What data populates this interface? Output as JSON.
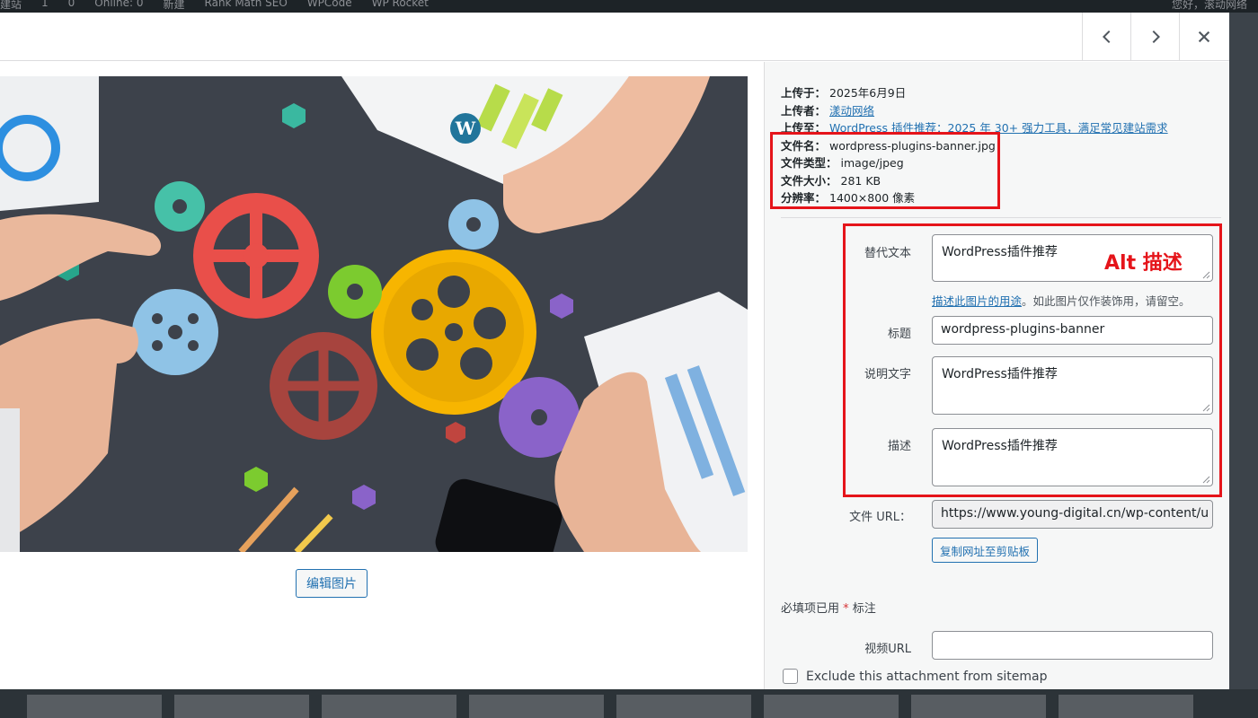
{
  "admin_bar": {
    "items": [
      "建站",
      "1",
      "0",
      "Online: 0",
      "新建",
      "Rank Math SEO",
      "WPCode",
      "WP Rocket"
    ],
    "right_text": "您好，滚动网络"
  },
  "nav": {
    "prev_icon": "chevron-left-icon",
    "next_icon": "chevron-right-icon",
    "close_icon": "close-icon"
  },
  "image": {
    "edit_button": "编辑图片"
  },
  "details": {
    "uploaded_on_label": "上传于：",
    "uploaded_on": "2025年6月9日",
    "uploaded_by_label": "上传者：",
    "uploaded_by": "漾动网络",
    "uploaded_to_label": "上传至：",
    "uploaded_to": "WordPress 插件推荐：2025 年 30+ 强力工具，满足常见建站需求",
    "file_name_label": "文件名：",
    "file_name": "wordpress-plugins-banner.jpg",
    "file_type_label": "文件类型：",
    "file_type": "image/jpeg",
    "file_size_label": "文件大小：",
    "file_size": "281 KB",
    "dimensions_label": "分辨率：",
    "dimensions": "1400×800 像素"
  },
  "form": {
    "alt_label": "替代文本",
    "alt_value": "WordPress插件推荐",
    "alt_annotation": "Alt 描述",
    "alt_help_link": "描述此图片的用途",
    "alt_help_text": "。如此图片仅作装饰用，请留空。",
    "title_label": "标题",
    "title_value": "wordpress-plugins-banner",
    "caption_label": "说明文字",
    "caption_value": "WordPress插件推荐",
    "description_label": "描述",
    "description_value": "WordPress插件推荐",
    "file_url_label": "文件 URL：",
    "file_url_value": "https://www.young-digital.cn/wp-content/u",
    "copy_url_button": "复制网址至剪贴板",
    "required_text": "必填项已用",
    "required_star": "*",
    "required_suffix": "标注",
    "video_url_label": "视频URL",
    "video_url_value": "",
    "exclude_label": "Exclude this attachment from sitemap"
  },
  "colors": {
    "accent": "#2271b1",
    "annotation_red": "#e5141a"
  }
}
